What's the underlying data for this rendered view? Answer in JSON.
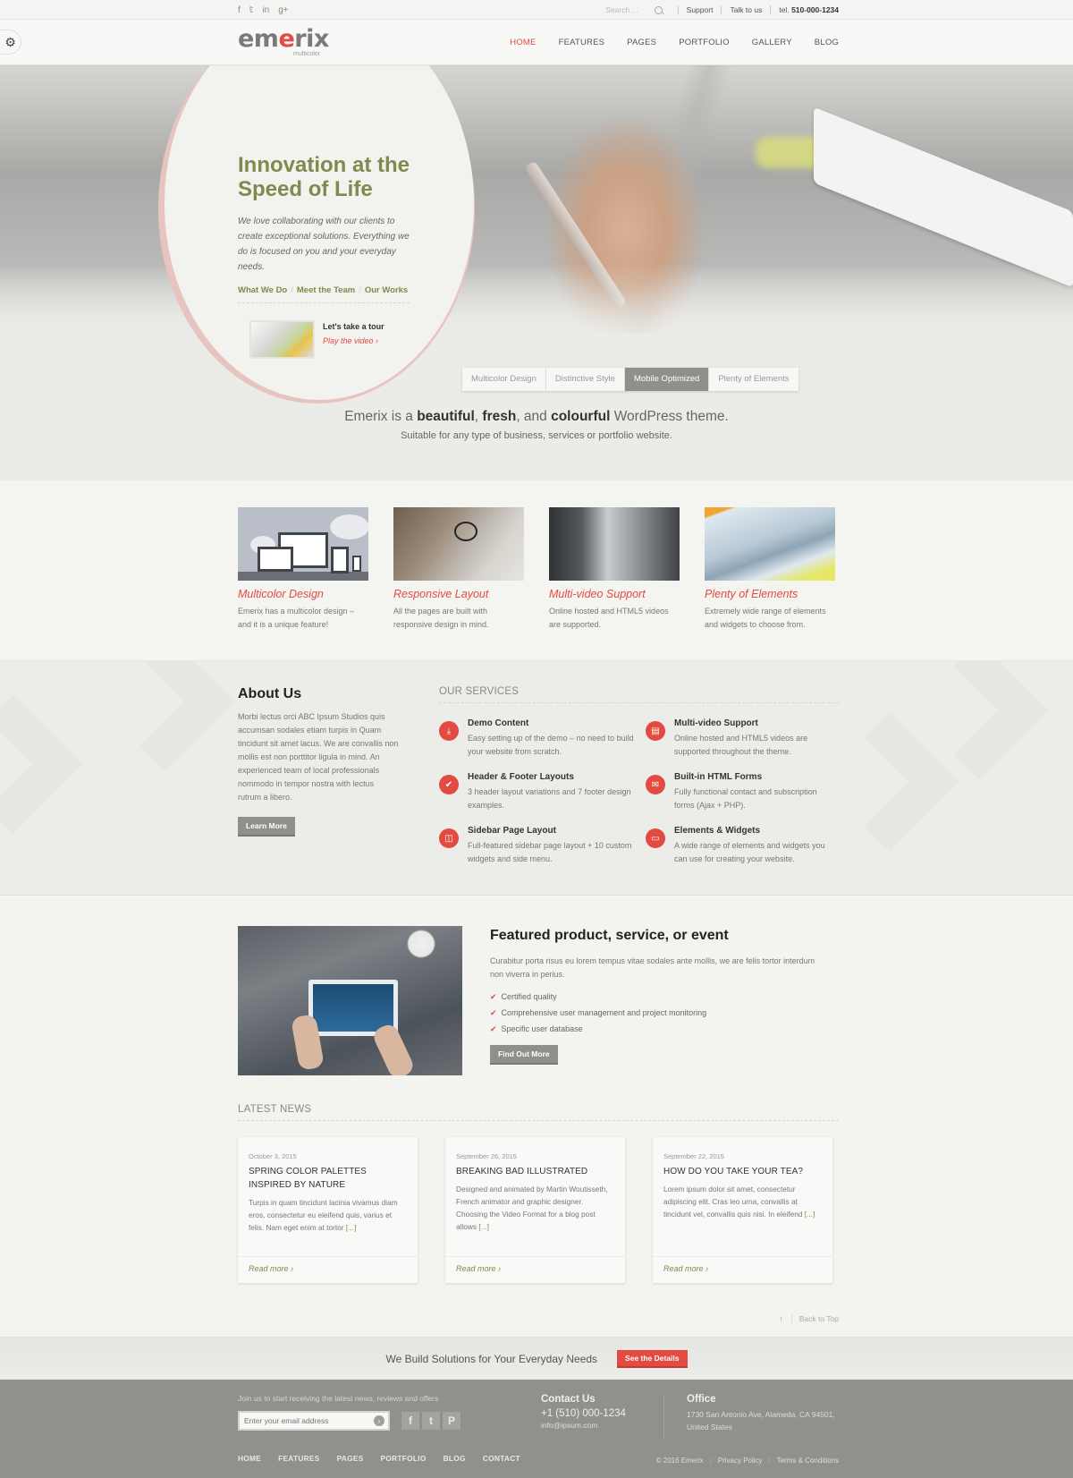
{
  "topbar": {
    "social": [
      {
        "icon": "facebook-icon",
        "glyph": "f"
      },
      {
        "icon": "twitter-icon",
        "glyph": "𝕥"
      },
      {
        "icon": "linkedin-icon",
        "glyph": "in"
      },
      {
        "icon": "googleplus-icon",
        "glyph": "g+"
      }
    ],
    "search_placeholder": "Search ...",
    "support": "Support",
    "talk": "Talk to us",
    "tel_label": "tel.",
    "tel_number": "510-000-1234"
  },
  "header": {
    "logo_main": "emerix",
    "logo_sub": "multicolor",
    "nav": [
      "HOME",
      "FEATURES",
      "PAGES",
      "PORTFOLIO",
      "GALLERY",
      "BLOG"
    ],
    "active_nav": "HOME"
  },
  "settings": {
    "icon": "gear-icon",
    "glyph": "⚙"
  },
  "hero": {
    "title_line1": "Innovation at the",
    "title_line2": "Speed of Life",
    "text": "We love collaborating with our clients to create exceptional solutions. Everything we do is focused on you and your everyday needs.",
    "links": [
      "What We Do",
      "Meet the Team",
      "Our Works"
    ],
    "tour_title": "Let's take a tour",
    "tour_play": "Play the video ›",
    "tabs": [
      "Multicolor Design",
      "Distinctive Style",
      "Mobile Optimized",
      "Plenty of Elements"
    ],
    "active_tab": "Mobile Optimized"
  },
  "tagline": {
    "p1": "Emerix is a ",
    "b1": "beautiful",
    "p2": ", ",
    "b2": "fresh",
    "p3": ", and ",
    "b3": "colourful",
    "p4": " WordPress theme.",
    "sub": "Suitable for any type of business, services or portfolio website."
  },
  "features": [
    {
      "title": "Multicolor Design",
      "text": "Emerix has a multicolor design – and it is a unique feature!"
    },
    {
      "title": "Responsive Layout",
      "text": "All the pages are built with responsive design in mind."
    },
    {
      "title": "Multi-video Support",
      "text": "Online hosted and HTML5 videos are supported."
    },
    {
      "title": "Plenty of Elements",
      "text": "Extremely wide range of elements and widgets to choose from."
    }
  ],
  "about": {
    "title": "About Us",
    "text": "Morbi lectus orci ABC Ipsum Studios quis accumsan sodales etiam turpis in Quam tincidunt sit amet lacus. We are convallis non mollis est non porttitor ligula in mind. An experienced team of local professionals nommodo in tempor nostra with lectus rutrum a libero.",
    "button": "Learn More"
  },
  "services": {
    "title": "OUR SERVICES",
    "items": [
      {
        "icon": "download-icon",
        "glyph": "⤓",
        "title": "Demo Content",
        "text": "Easy setting up of the demo – no need to build your website from scratch."
      },
      {
        "icon": "film-icon",
        "glyph": "▤",
        "title": "Multi-video Support",
        "text": "Online hosted and HTML5 videos are supported throughout the theme."
      },
      {
        "icon": "check-icon",
        "glyph": "✔",
        "title": "Header & Footer Layouts",
        "text": "3 header layout variations and 7 footer design examples."
      },
      {
        "icon": "envelope-icon",
        "glyph": "✉",
        "title": "Built-in HTML Forms",
        "text": "Fully functional contact and subscription forms (Ajax + PHP)."
      },
      {
        "icon": "columns-icon",
        "glyph": "◫",
        "title": "Sidebar Page Layout",
        "text": "Full-featured sidebar page layout + 10 custom widgets and side menu."
      },
      {
        "icon": "monitor-icon",
        "glyph": "▭",
        "title": "Elements & Widgets",
        "text": "A wide range of elements and widgets you can use for creating your website."
      }
    ]
  },
  "featured": {
    "title": "Featured product, service, or event",
    "text": "Curabitur porta risus eu lorem tempus vitae sodales ante mollis, we are felis tortor interdum non viverra in perius.",
    "checks": [
      "Certified quality",
      "Comprehensive user management and project monitoring",
      "Specific user database"
    ],
    "button": "Find Out More"
  },
  "news": {
    "title": "LATEST NEWS",
    "items": [
      {
        "date": "October 3, 2015",
        "title": "SPRING COLOR PALETTES INSPIRED BY NATURE",
        "text": "Turpis in quam tincidunt lacinia vivamus diam eros, consectetur eu eleifend quis, varius et felis. Nam eget enim at tortor",
        "more": "[...]",
        "read": "Read more ›"
      },
      {
        "date": "September 26, 2015",
        "title": "BREAKING BAD ILLUSTRATED",
        "text": "Designed and animated by Martin Woutisseth, French animator and graphic designer. Choosing the Video Format for a blog post allows",
        "more": "[...]",
        "read": "Read more ›"
      },
      {
        "date": "September 22, 2015",
        "title": "HOW DO YOU TAKE YOUR TEA?",
        "text": "Lorem ipsum dolor sit amet, consectetur adipiscing elit. Cras leo urna, convallis at tincidunt vel, convallis quis nisi. In eleifend",
        "more": "[...]",
        "read": "Read more ›"
      }
    ],
    "back_to_top": "Back to Top"
  },
  "cta": {
    "text": "We Build Solutions for Your Everyday Needs",
    "button": "See the Details"
  },
  "footer": {
    "join_text": "Join us to start receiving the latest news, reviews and offers",
    "email_placeholder": "Enter your email address",
    "social": [
      {
        "icon": "facebook-icon",
        "glyph": "f"
      },
      {
        "icon": "twitter-icon",
        "glyph": "t"
      },
      {
        "icon": "pinterest-icon",
        "glyph": "P"
      }
    ],
    "nav": [
      "HOME",
      "FEATURES",
      "PAGES",
      "PORTFOLIO",
      "BLOG",
      "CONTACT"
    ],
    "contact_title": "Contact Us",
    "phone": "+1 (510) 000-1234",
    "email": "info@ipsum.com",
    "office_title": "Office",
    "address": "1730 San Antonio Ave, Alameda, CA 94501, United States",
    "copyright": "© 2016 Emerix",
    "privacy": "Privacy Policy",
    "terms": "Terms & Conditions"
  },
  "colors": {
    "accent_red": "#e24a42",
    "olive": "#7d8c4e",
    "footer_gray": "#8e928b"
  }
}
